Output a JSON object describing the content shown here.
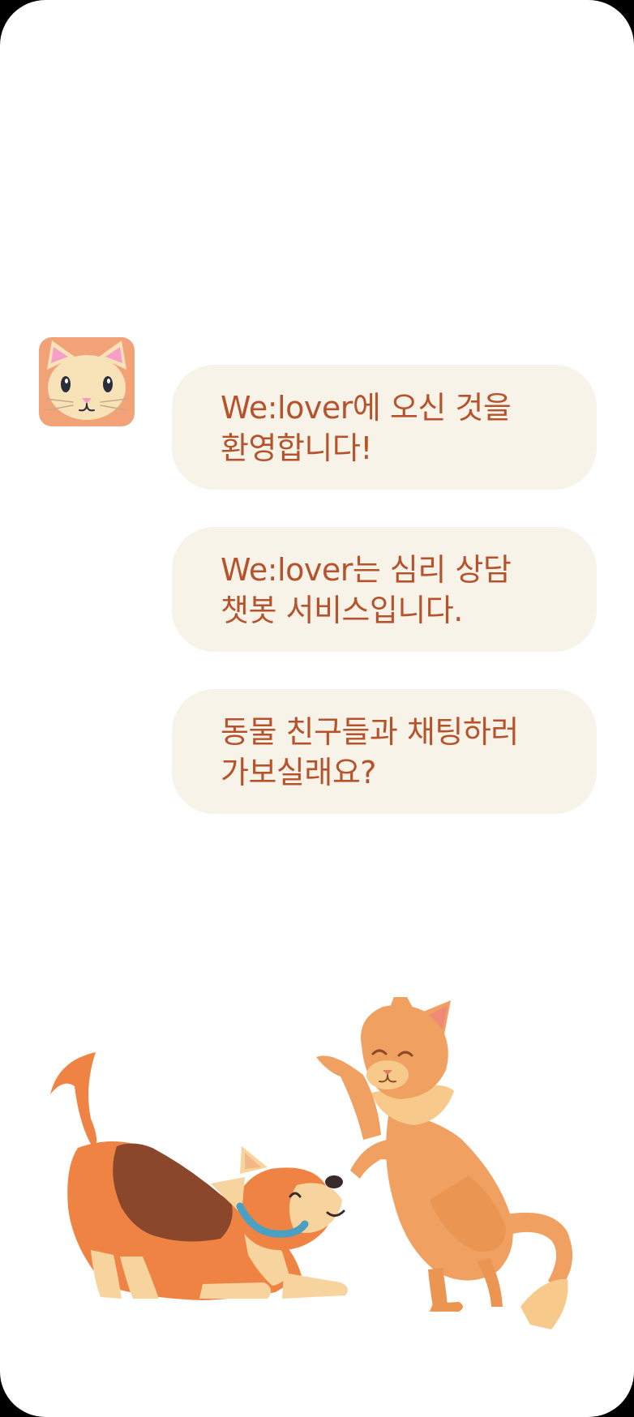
{
  "chat": {
    "avatar_icon": "cat-face-icon",
    "messages": [
      {
        "text": "We:lover에 오신 것을\n환영합니다!"
      },
      {
        "text": "We:lover는 심리 상담\n챗봇 서비스입니다."
      },
      {
        "text": "동물 친구들과 채팅하러\n가보실래요?"
      }
    ]
  },
  "illustration": {
    "icons": [
      "dog-illustration",
      "cat-illustration"
    ]
  },
  "colors": {
    "bubble_bg": "#f7f3e8",
    "text": "#b5532c",
    "avatar_bg": "#f2a277",
    "screen_bg": "#ffffff"
  }
}
